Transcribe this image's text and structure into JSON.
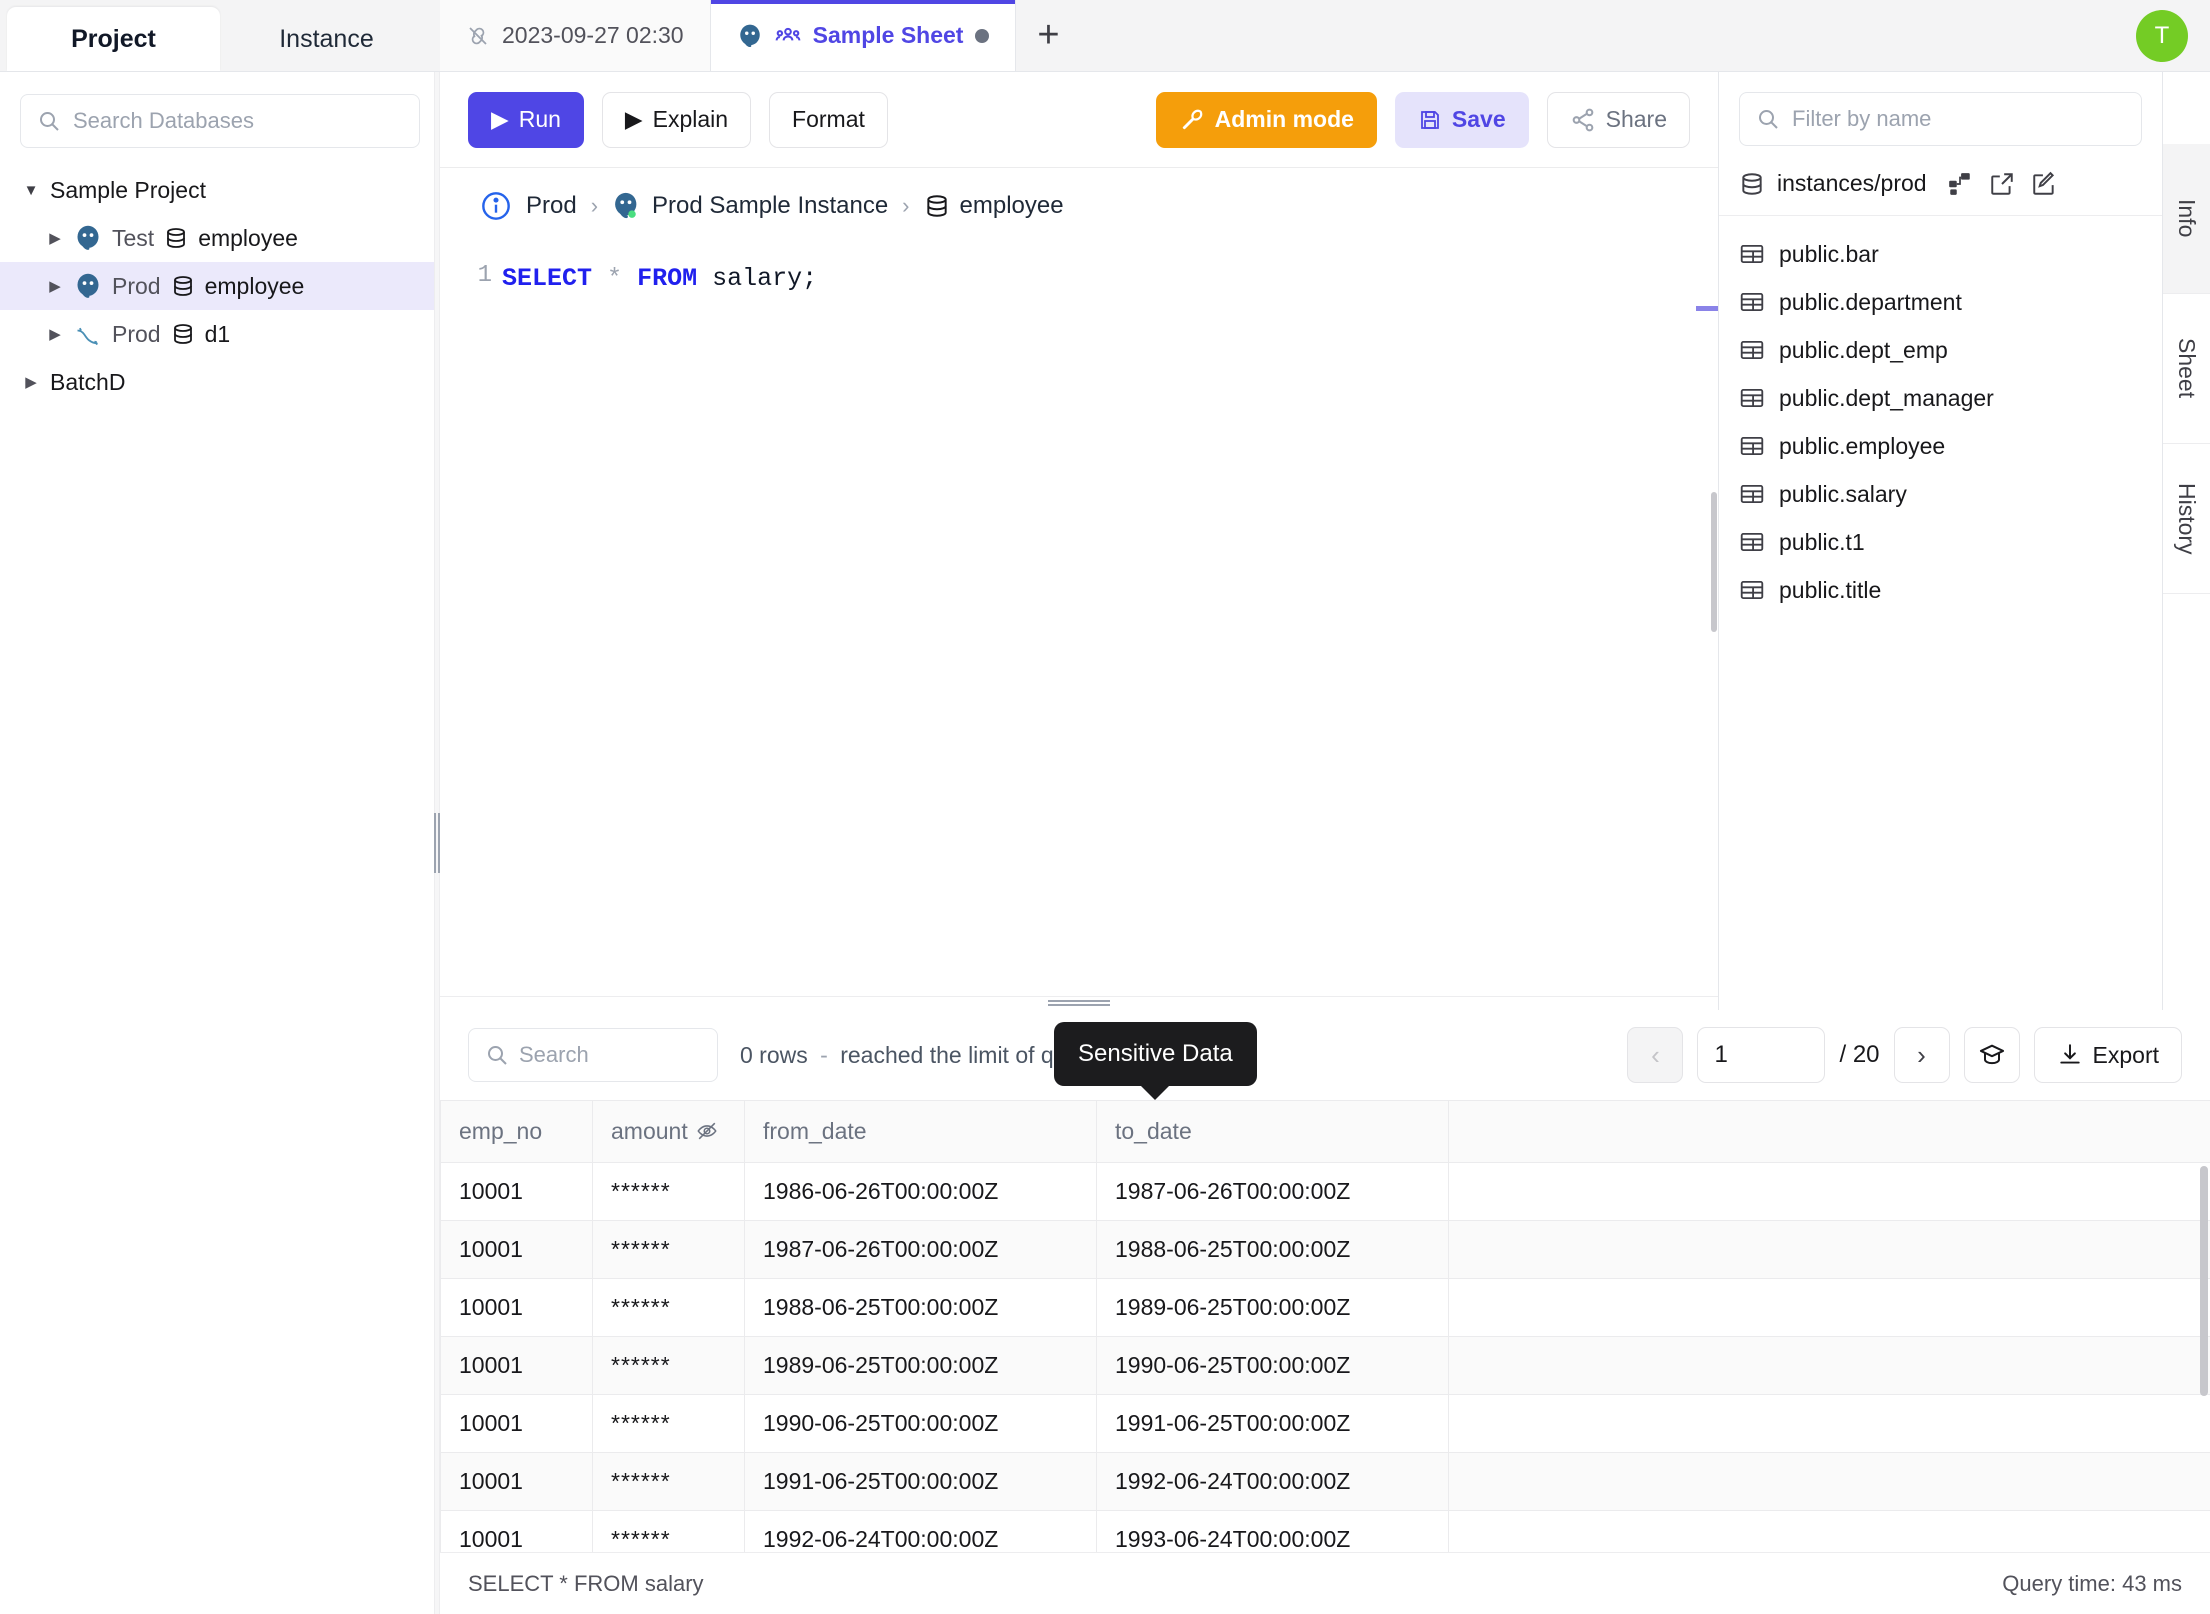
{
  "sidebar": {
    "tabs": [
      {
        "label": "Project",
        "active": true
      },
      {
        "label": "Instance",
        "active": false
      }
    ],
    "search_placeholder": "Search Databases",
    "search_value": "",
    "tree": [
      {
        "label": "Sample Project",
        "type": "project",
        "expanded": true
      },
      {
        "env": "Test",
        "label": "employee",
        "type": "postgres",
        "selected": false
      },
      {
        "env": "Prod",
        "label": "employee",
        "type": "postgres",
        "selected": true
      },
      {
        "env": "Prod",
        "label": "d1",
        "type": "mysql",
        "selected": false
      },
      {
        "label": "BatchD",
        "type": "project",
        "expanded": false
      }
    ]
  },
  "tabbar": {
    "tabs": [
      {
        "label": "2023-09-27 02:30",
        "active": false,
        "icon": "unlinked-icon",
        "dirty": false
      },
      {
        "label": "Sample Sheet",
        "active": true,
        "icon": "postgres-icon",
        "shared": true,
        "dirty": true
      }
    ],
    "add_label": "+",
    "avatar_initial": "T"
  },
  "toolbar": {
    "run_label": "Run",
    "explain_label": "Explain",
    "format_label": "Format",
    "admin_label": "Admin mode",
    "save_label": "Save",
    "share_label": "Share"
  },
  "breadcrumb": {
    "environment": "Prod",
    "instance": "Prod Sample Instance",
    "database": "employee",
    "separator": "›"
  },
  "editor": {
    "line_number": "1",
    "code_tokens": [
      {
        "text": "SELECT",
        "type": "keyword"
      },
      {
        "text": " ",
        "type": "plain"
      },
      {
        "text": "*",
        "type": "operator"
      },
      {
        "text": " ",
        "type": "plain"
      },
      {
        "text": "FROM",
        "type": "keyword"
      },
      {
        "text": " salary;",
        "type": "plain"
      }
    ],
    "statement": "SELECT * FROM salary;"
  },
  "schema_panel": {
    "filter_placeholder": "Filter by name",
    "filter_value": "",
    "database_label": "instances/prod",
    "actions": [
      "schema-diagram-icon",
      "external-link-icon",
      "edit-icon"
    ],
    "tables": [
      "public.bar",
      "public.department",
      "public.dept_emp",
      "public.dept_manager",
      "public.employee",
      "public.salary",
      "public.t1",
      "public.title"
    ]
  },
  "right_tabs": [
    {
      "label": "Info",
      "active": true
    },
    {
      "label": "Sheet",
      "active": false
    },
    {
      "label": "History",
      "active": false
    }
  ],
  "results": {
    "search_placeholder": "Search",
    "search_value": "",
    "rows_text": "0 rows",
    "limit_text": "reached the limit of query results",
    "separator": "-",
    "tooltip": "Sensitive Data",
    "pagination": {
      "prev_label": "‹",
      "next_label": "›",
      "page": "1",
      "total": "/ 20"
    },
    "export_label": "Export",
    "columns": [
      "emp_no",
      "amount",
      "from_date",
      "to_date",
      ""
    ],
    "sensitive_column": "amount",
    "rows": [
      [
        "10001",
        "******",
        "1986-06-26T00:00:00Z",
        "1987-06-26T00:00:00Z",
        ""
      ],
      [
        "10001",
        "******",
        "1987-06-26T00:00:00Z",
        "1988-06-25T00:00:00Z",
        ""
      ],
      [
        "10001",
        "******",
        "1988-06-25T00:00:00Z",
        "1989-06-25T00:00:00Z",
        ""
      ],
      [
        "10001",
        "******",
        "1989-06-25T00:00:00Z",
        "1990-06-25T00:00:00Z",
        ""
      ],
      [
        "10001",
        "******",
        "1990-06-25T00:00:00Z",
        "1991-06-25T00:00:00Z",
        ""
      ],
      [
        "10001",
        "******",
        "1991-06-25T00:00:00Z",
        "1992-06-24T00:00:00Z",
        ""
      ],
      [
        "10001",
        "******",
        "1992-06-24T00:00:00Z",
        "1993-06-24T00:00:00Z",
        ""
      ]
    ]
  },
  "statusbar": {
    "statement": "SELECT * FROM salary",
    "query_time": "Query time: 43 ms"
  },
  "colors": {
    "accent": "#4f46e5",
    "admin": "#f59e0b",
    "save_bg": "#e5e3fb",
    "selected_row": "#ebe9fb",
    "avatar": "#74cc25",
    "tooltip_bg": "#1c1c1e"
  }
}
